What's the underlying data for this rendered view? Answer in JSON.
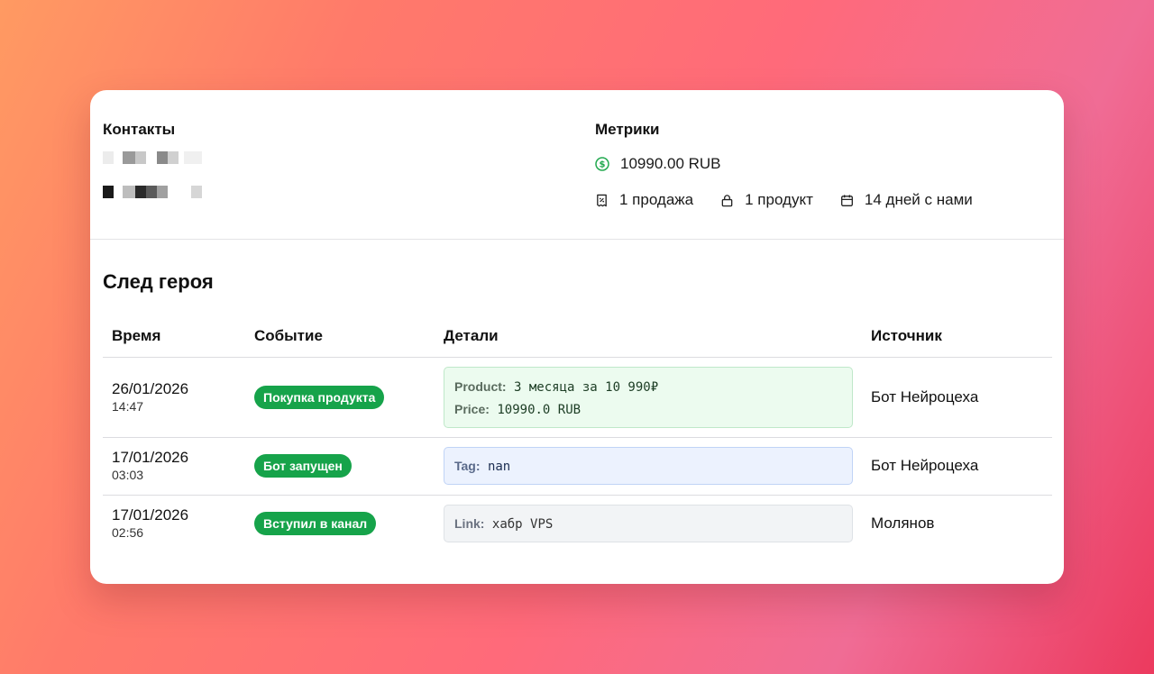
{
  "contacts": {
    "title": "Контакты"
  },
  "metrics": {
    "title": "Метрики",
    "amount": "10990.00 RUB",
    "sales": "1 продажа",
    "products": "1 продукт",
    "days": "14 дней с нами"
  },
  "hero": {
    "title": "След героя"
  },
  "table": {
    "headers": [
      "Время",
      "Событие",
      "Детали",
      "Источник"
    ],
    "rows": [
      {
        "date": "26/01/2026",
        "time": "14:47",
        "event": "Покупка продукта",
        "details": [
          {
            "key": "Product:",
            "value": "3 месяца за 10 990₽"
          },
          {
            "key": "Price:",
            "value": "10990.0 RUB"
          }
        ],
        "source": "Бот Нейроцеха"
      },
      {
        "date": "17/01/2026",
        "time": "03:03",
        "event": "Бот запущен",
        "details": [
          {
            "key": "Tag:",
            "value": "nan"
          }
        ],
        "source": "Бот Нейроцеха"
      },
      {
        "date": "17/01/2026",
        "time": "02:56",
        "event": "Вступил в канал",
        "details": [
          {
            "key": "Link:",
            "value": "хабр VPS"
          }
        ],
        "source": "Молянов"
      }
    ]
  },
  "colors": {
    "badge": "#16a34a",
    "money_icon": "#22a94f"
  },
  "icons": [
    "dollar-circle-icon",
    "receipt-icon",
    "lock-icon",
    "calendar-icon"
  ]
}
